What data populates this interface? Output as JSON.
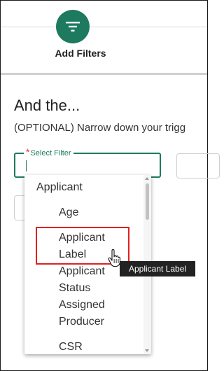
{
  "toolbar": {
    "add_filters_label": "Add Filters",
    "icon": "filter-icon"
  },
  "main": {
    "heading": "And the...",
    "subtext": "(OPTIONAL) Narrow down your trigg"
  },
  "select": {
    "required_mark": "*",
    "label": "Select Filter",
    "value": ""
  },
  "dropdown": {
    "group_label": "Applicant",
    "items": [
      {
        "lines": [
          "Age"
        ]
      },
      {
        "lines": [
          "Applicant",
          "Label"
        ]
      },
      {
        "lines": [
          "Applicant",
          "Status"
        ]
      },
      {
        "lines": [
          "Assigned",
          "Producer"
        ]
      },
      {
        "lines": [
          "CSR"
        ]
      }
    ]
  },
  "tooltip": {
    "text": "Applicant Label"
  },
  "colors": {
    "accent": "#1e7a5f",
    "required": "#d33333",
    "highlight": "#e02020",
    "tooltip_bg": "#222222"
  }
}
